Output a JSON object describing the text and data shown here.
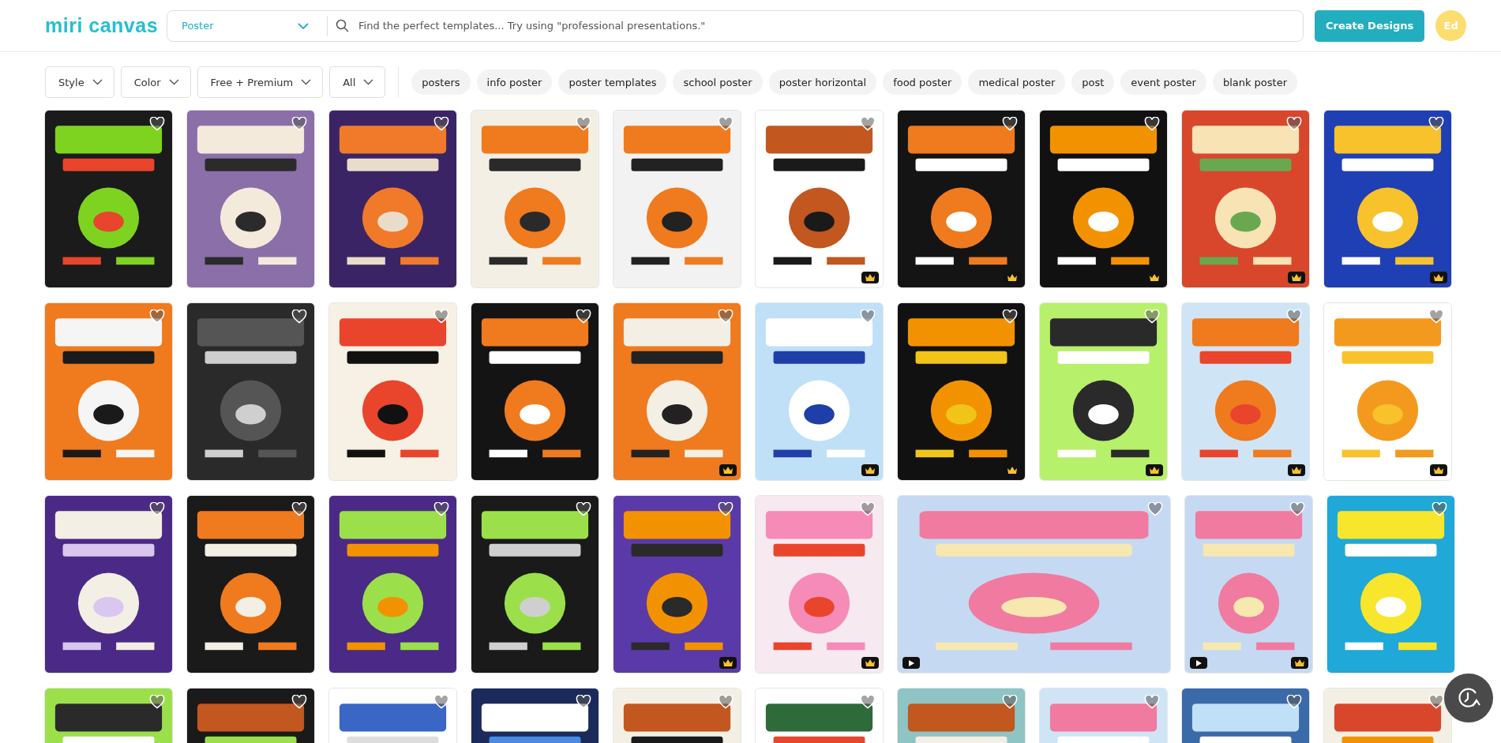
{
  "header": {
    "logo": "miri canvas",
    "category": "Poster",
    "search_placeholder": "Find the perfect templates... Try using \"professional presentations.\"",
    "create_button": "Create Designs",
    "avatar": "Ed"
  },
  "filters": [
    "Style",
    "Color",
    "Free + Premium",
    "All"
  ],
  "chips": [
    "posters",
    "info poster",
    "poster templates",
    "school poster",
    "poster horizontal",
    "food poster",
    "medical poster",
    "post",
    "event poster",
    "blank poster"
  ],
  "rows": [
    {
      "cards": [
        {
          "kind": "portrait",
          "premium": false,
          "video": false
        },
        {
          "kind": "portrait",
          "premium": false,
          "video": false
        },
        {
          "kind": "portrait",
          "premium": false,
          "video": false
        },
        {
          "kind": "portrait",
          "premium": false,
          "video": false
        },
        {
          "kind": "portrait",
          "premium": false,
          "video": false
        },
        {
          "kind": "portrait",
          "premium": true,
          "video": false
        },
        {
          "kind": "portrait",
          "premium": true,
          "video": false
        },
        {
          "kind": "portrait",
          "premium": true,
          "video": false
        },
        {
          "kind": "portrait",
          "premium": true,
          "video": false
        },
        {
          "kind": "portrait",
          "premium": true,
          "video": false
        }
      ]
    },
    {
      "cards": [
        {
          "kind": "portrait",
          "premium": false,
          "video": false
        },
        {
          "kind": "portrait",
          "premium": false,
          "video": false
        },
        {
          "kind": "portrait",
          "premium": false,
          "video": false
        },
        {
          "kind": "portrait",
          "premium": false,
          "video": false
        },
        {
          "kind": "portrait",
          "premium": true,
          "video": false
        },
        {
          "kind": "portrait",
          "premium": true,
          "video": false
        },
        {
          "kind": "portrait",
          "premium": true,
          "video": false
        },
        {
          "kind": "portrait",
          "premium": true,
          "video": false
        },
        {
          "kind": "portrait",
          "premium": true,
          "video": false
        },
        {
          "kind": "portrait",
          "premium": true,
          "video": false
        }
      ]
    },
    {
      "cards": [
        {
          "kind": "portrait",
          "premium": false,
          "video": false
        },
        {
          "kind": "portrait",
          "premium": false,
          "video": false
        },
        {
          "kind": "portrait",
          "premium": false,
          "video": false
        },
        {
          "kind": "portrait",
          "premium": false,
          "video": false
        },
        {
          "kind": "portrait",
          "premium": true,
          "video": false
        },
        {
          "kind": "portrait",
          "premium": true,
          "video": false
        },
        {
          "kind": "landscape",
          "premium": false,
          "video": true
        },
        {
          "kind": "portrait",
          "premium": true,
          "video": true
        },
        {
          "kind": "portrait",
          "premium": false,
          "video": false
        }
      ]
    },
    {
      "cards": [
        {
          "kind": "portrait",
          "premium": false,
          "video": false
        },
        {
          "kind": "portrait",
          "premium": false,
          "video": false
        },
        {
          "kind": "portrait",
          "premium": false,
          "video": false
        },
        {
          "kind": "portrait",
          "premium": false,
          "video": false
        },
        {
          "kind": "portrait",
          "premium": false,
          "video": false
        },
        {
          "kind": "portrait",
          "premium": false,
          "video": false
        },
        {
          "kind": "portrait",
          "premium": false,
          "video": false
        },
        {
          "kind": "portrait",
          "premium": false,
          "video": false
        },
        {
          "kind": "portrait",
          "premium": false,
          "video": false
        },
        {
          "kind": "portrait",
          "premium": false,
          "video": false
        }
      ]
    }
  ]
}
